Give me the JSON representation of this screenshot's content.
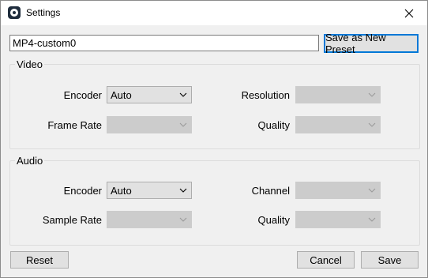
{
  "window": {
    "title": "Settings"
  },
  "preset": {
    "name_value": "MP4-custom0",
    "save_as_new_label": "Save as New Preset"
  },
  "video": {
    "group_label": "Video",
    "encoder_label": "Encoder",
    "encoder_value": "Auto",
    "frame_rate_label": "Frame Rate",
    "frame_rate_value": "",
    "resolution_label": "Resolution",
    "resolution_value": "",
    "quality_label": "Quality",
    "quality_value": ""
  },
  "audio": {
    "group_label": "Audio",
    "encoder_label": "Encoder",
    "encoder_value": "Auto",
    "sample_rate_label": "Sample Rate",
    "sample_rate_value": "",
    "channel_label": "Channel",
    "channel_value": "",
    "quality_label": "Quality",
    "quality_value": ""
  },
  "footer": {
    "reset_label": "Reset",
    "cancel_label": "Cancel",
    "save_label": "Save"
  },
  "icons": {
    "app": "app-icon",
    "close": "close-icon",
    "dropdown": "chevron-down-icon"
  },
  "colors": {
    "accent": "#0078d7",
    "dialog_bg": "#f0f0f0",
    "disabled_combo": "#cccccc"
  }
}
